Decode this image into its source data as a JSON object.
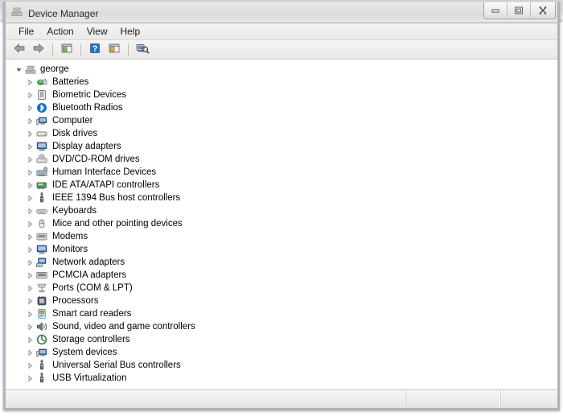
{
  "window": {
    "title": "Device Manager",
    "icon": "device-manager-icon",
    "controls": [
      {
        "name": "minimize-button",
        "glyph": "minimize"
      },
      {
        "name": "maximize-button",
        "glyph": "maximize"
      },
      {
        "name": "close-button",
        "glyph": "close"
      }
    ]
  },
  "menubar": {
    "items": [
      {
        "name": "menu-file",
        "label": "File"
      },
      {
        "name": "menu-action",
        "label": "Action"
      },
      {
        "name": "menu-view",
        "label": "View"
      },
      {
        "name": "menu-help",
        "label": "Help"
      }
    ]
  },
  "toolbar": {
    "buttons": [
      {
        "name": "back-button",
        "icon": "back-arrow-icon"
      },
      {
        "name": "forward-button",
        "icon": "forward-arrow-icon"
      },
      {
        "name": "show-hide-console-tree",
        "icon": "console-tree-icon"
      },
      {
        "name": "help-button",
        "icon": "help-question-icon"
      },
      {
        "name": "properties-button",
        "icon": "properties-icon"
      },
      {
        "name": "scan-hardware-changes",
        "icon": "scan-hardware-icon"
      }
    ]
  },
  "tree": {
    "root": {
      "label": "george",
      "icon": "computer-root-icon",
      "expanded": true
    },
    "children": [
      {
        "label": "Batteries",
        "icon": "batteries-icon",
        "color": "#2e8b33"
      },
      {
        "label": "Biometric Devices",
        "icon": "biometric-icon",
        "color": "#7b7f86"
      },
      {
        "label": "Bluetooth Radios",
        "icon": "bluetooth-icon",
        "color": "#1673c8"
      },
      {
        "label": "Computer",
        "icon": "computer-icon",
        "color": "#3a5e8c"
      },
      {
        "label": "Disk drives",
        "icon": "disk-drive-icon",
        "color": "#9a9489"
      },
      {
        "label": "Display adapters",
        "icon": "display-adapter-icon",
        "color": "#2f5fa0"
      },
      {
        "label": "DVD/CD-ROM drives",
        "icon": "dvd-drive-icon",
        "color": "#8d8d8d"
      },
      {
        "label": "Human Interface Devices",
        "icon": "hid-icon",
        "color": "#6f7b86"
      },
      {
        "label": "IDE ATA/ATAPI controllers",
        "icon": "ide-controller-icon",
        "color": "#4f9b5c"
      },
      {
        "label": "IEEE 1394 Bus host controllers",
        "icon": "ieee1394-icon",
        "color": "#6b7280"
      },
      {
        "label": "Keyboards",
        "icon": "keyboard-icon",
        "color": "#8a8f95"
      },
      {
        "label": "Mice and other pointing devices",
        "icon": "mouse-icon",
        "color": "#7d838a"
      },
      {
        "label": "Modems",
        "icon": "modem-icon",
        "color": "#7f858c"
      },
      {
        "label": "Monitors",
        "icon": "monitor-icon",
        "color": "#2f5fa0"
      },
      {
        "label": "Network adapters",
        "icon": "network-adapter-icon",
        "color": "#2f5fa0"
      },
      {
        "label": "PCMCIA adapters",
        "icon": "pcmcia-icon",
        "color": "#6e7884"
      },
      {
        "label": "Ports (COM & LPT)",
        "icon": "ports-icon",
        "color": "#8a8f95"
      },
      {
        "label": "Processors",
        "icon": "processor-icon",
        "color": "#5b6570"
      },
      {
        "label": "Smart card readers",
        "icon": "smartcard-icon",
        "color": "#4a8fbf"
      },
      {
        "label": "Sound, video and game controllers",
        "icon": "sound-icon",
        "color": "#6b7a88"
      },
      {
        "label": "Storage controllers",
        "icon": "storage-controller-icon",
        "color": "#3d7a4e"
      },
      {
        "label": "System devices",
        "icon": "system-device-icon",
        "color": "#3a5e8c"
      },
      {
        "label": "Universal Serial Bus controllers",
        "icon": "usb-controller-icon",
        "color": "#6b7280"
      },
      {
        "label": "USB Virtualization",
        "icon": "usb-virtualization-icon",
        "color": "#6b7280"
      }
    ]
  },
  "statusbar": {
    "main": "",
    "mid": "",
    "end": ""
  }
}
